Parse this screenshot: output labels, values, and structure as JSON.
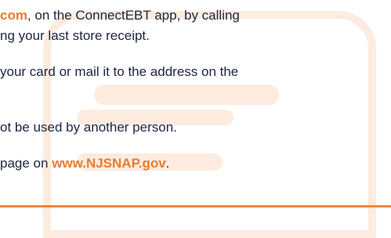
{
  "lines": {
    "l1": {
      "accent": "com",
      "rest": ", on the ConnectEBT app, by calling"
    },
    "l2": {
      "text": "ng your last store receipt."
    },
    "l3": {
      "text": "your card or mail it to the address on the"
    },
    "l4": {
      "text": "ot be used by another person."
    },
    "l5": {
      "pre": "page on ",
      "accent": "www.NJSNAP.gov",
      "post": "."
    }
  },
  "colors": {
    "accent": "#e87b2d",
    "text": "#1c2541",
    "background_shape": "#fdebdf",
    "rule": "#ee8a3c"
  }
}
